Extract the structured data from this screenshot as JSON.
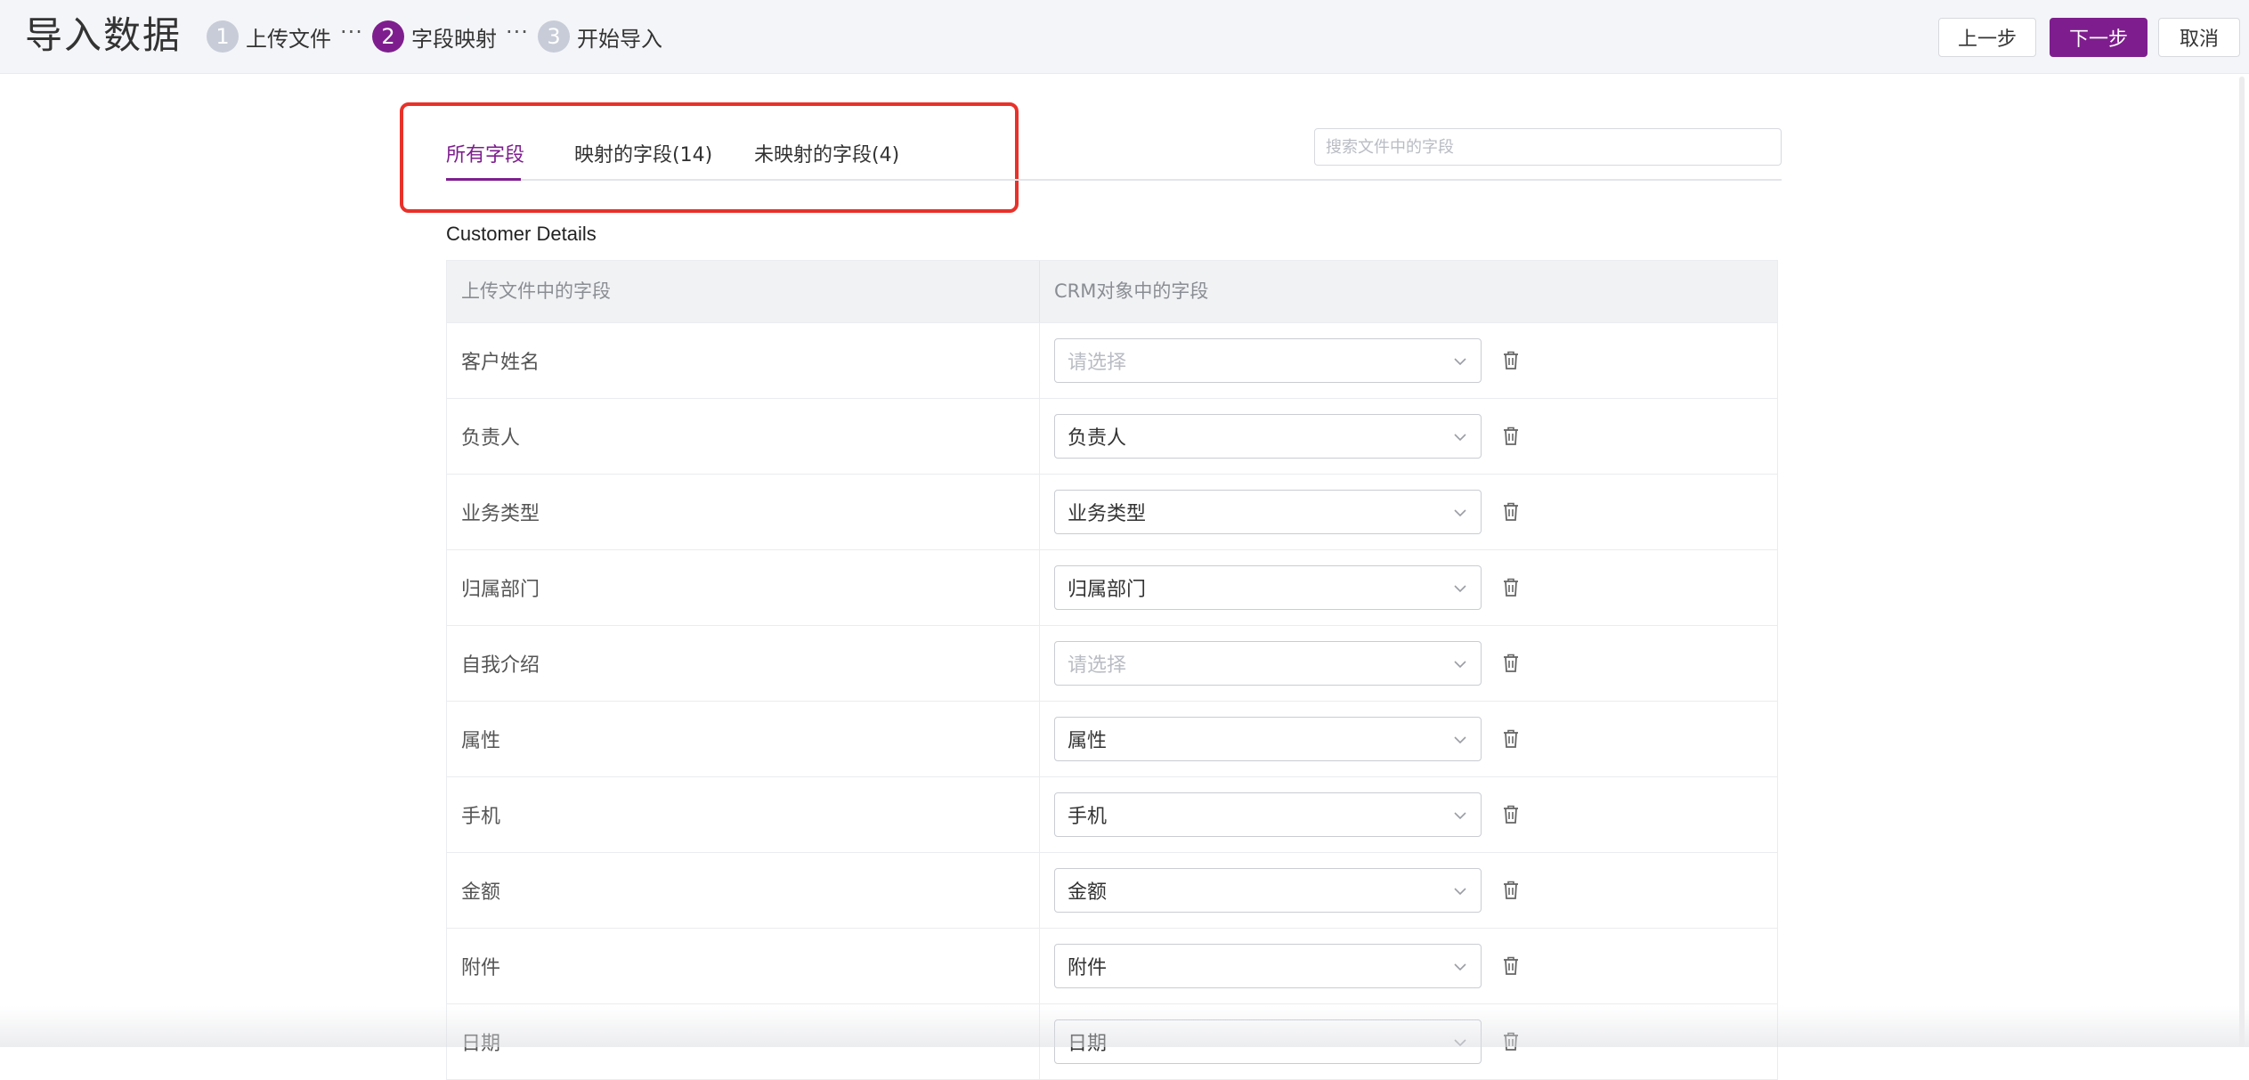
{
  "header": {
    "title": "导入数据",
    "steps": [
      {
        "num": "1",
        "label": "上传文件"
      },
      {
        "num": "2",
        "label": "字段映射"
      },
      {
        "num": "3",
        "label": "开始导入"
      }
    ],
    "dots": "···",
    "buttons": {
      "prev": "上一步",
      "next": "下一步",
      "cancel": "取消"
    }
  },
  "tabs": [
    {
      "label": "所有字段"
    },
    {
      "label": "映射的字段(14)"
    },
    {
      "label": "未映射的字段(4)"
    }
  ],
  "search": {
    "placeholder": "搜索文件中的字段",
    "value": ""
  },
  "section": {
    "title": "Customer Details"
  },
  "table": {
    "headers": {
      "source": "上传文件中的字段",
      "target": "CRM对象中的字段"
    },
    "select_placeholder": "请选择",
    "rows": [
      {
        "source": "客户姓名",
        "target": "请选择"
      },
      {
        "source": "负责人",
        "target": "负责人"
      },
      {
        "source": "业务类型",
        "target": "业务类型"
      },
      {
        "source": "归属部门",
        "target": "归属部门"
      },
      {
        "source": "自我介绍",
        "target": "请选择"
      },
      {
        "source": "属性",
        "target": "属性"
      },
      {
        "source": "手机",
        "target": "手机"
      },
      {
        "source": "金额",
        "target": "金额"
      },
      {
        "source": "附件",
        "target": "附件"
      },
      {
        "source": "日期",
        "target": "日期"
      }
    ]
  },
  "colors": {
    "accent": "#7e1e8e",
    "highlight_border": "#e8312a"
  },
  "icons": {
    "row_action": "trash-icon",
    "select_arrow": "chevron-down-icon"
  }
}
